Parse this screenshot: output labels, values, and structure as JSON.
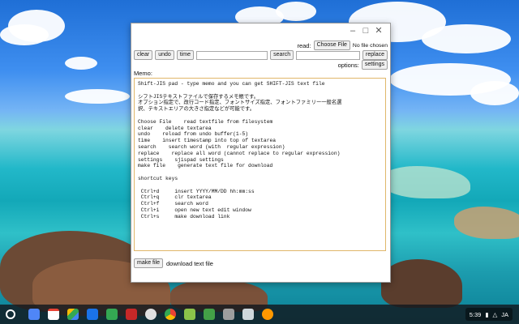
{
  "window": {
    "read_label": "read:",
    "choose_file_button": "Choose File",
    "no_file_text": "No file chosen",
    "toolbar": {
      "clear": "clear",
      "undo": "undo",
      "time": "time",
      "search": "search",
      "replace": "replace"
    },
    "options_label": "options:",
    "settings_button": "settings",
    "memo_label": "Memo:",
    "memo_text": "Shift-JIS pad - type memo and you can get SHIFT-JIS text file\n\nシフトJISテキストファイルで保存するメモ帳です。\nオプション指定で、改行コード指定、フォントサイズ指定、フォントファミリー一般名選\n択、テキストエリアの大きさ指定などが可能です。\n\nChoose File    read textfile from filesystem\nclear    delete textarea\nundo    reload from undo buffer(1-5)\ntime    insert timestamp into top of textarea\nsearch    search word (with  regular expression)\nreplace    replace all word (cannot replace to regular expression)\nsettings    sjispad settings\nmake file    generate text file for download\n\nshortcut keys\n\n Ctrl+d     insert YYYY/MM/DD hh:mm:ss\n Ctrl+q     clr textarea\n Ctrl+f     search word\n Ctrl+i     open new text edit window\n Ctrl+s     make download link\n",
    "make_file_button": "make file",
    "download_label": "download text file"
  },
  "shelf": {
    "apps": [
      "launcher-icon",
      "files-icon",
      "gmail-icon",
      "drive-icon",
      "photos-icon",
      "maps-icon",
      "app-icon",
      "chrome-icon",
      "store-icon",
      "doc-icon",
      "app2-icon",
      "app3-icon",
      "android-icon"
    ],
    "clock": "5:39",
    "ime": "JA",
    "accent_colors": {
      "chrome_red": "#ea4335",
      "chrome_green": "#34a853",
      "chrome_yellow": "#fbbc05",
      "chrome_blue": "#4285f4"
    }
  }
}
